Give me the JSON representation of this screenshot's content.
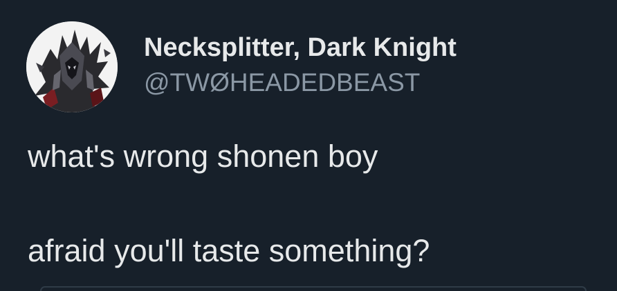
{
  "post": {
    "author": {
      "display_name": "Necksplitter, Dark Knight",
      "handle": "@TWØHEADEDBEAST",
      "avatar_icon": "dark-armored-knight-avatar"
    },
    "text_lines": [
      "what's wrong shonen boy",
      "afraid you'll taste something?"
    ]
  },
  "theme": {
    "background": "#17202a",
    "primary_text": "#e7e9ea",
    "secondary_text": "#8b98a5"
  }
}
